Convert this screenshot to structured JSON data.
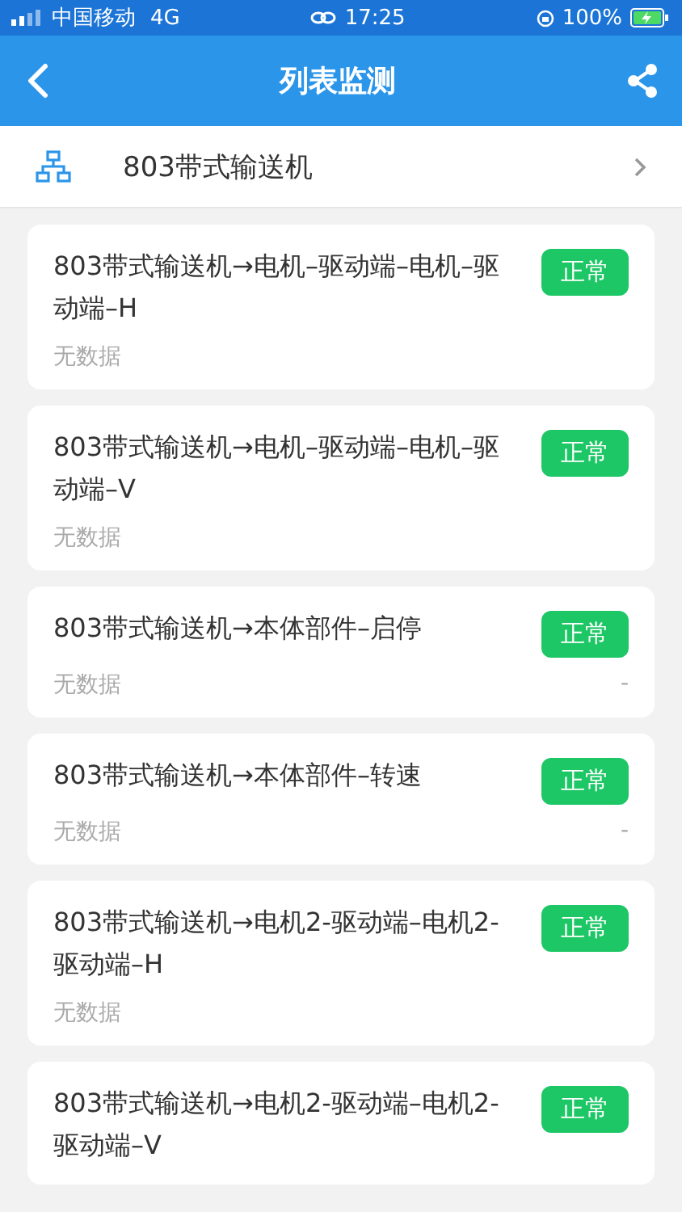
{
  "status_bar": {
    "carrier": "中国移动",
    "network": "4G",
    "time": "17:25",
    "battery": "100%"
  },
  "header": {
    "title": "列表监测"
  },
  "device": {
    "name": "803带式输送机"
  },
  "items": [
    {
      "title": "803带式输送机→电机–驱动端–电机–驱动端–H",
      "status": "正常",
      "data": "无数据"
    },
    {
      "title": "803带式输送机→电机–驱动端–电机–驱动端–V",
      "status": "正常",
      "data": "无数据"
    },
    {
      "title": "803带式输送机→本体部件–启停",
      "status": "正常",
      "data": "无数据",
      "value": "-"
    },
    {
      "title": "803带式输送机→本体部件–转速",
      "status": "正常",
      "data": "无数据",
      "value": "-"
    },
    {
      "title": "803带式输送机→电机2-驱动端–电机2-驱动端–H",
      "status": "正常",
      "data": "无数据"
    },
    {
      "title": "803带式输送机→电机2-驱动端–电机2-驱动端–V",
      "status": "正常"
    }
  ]
}
